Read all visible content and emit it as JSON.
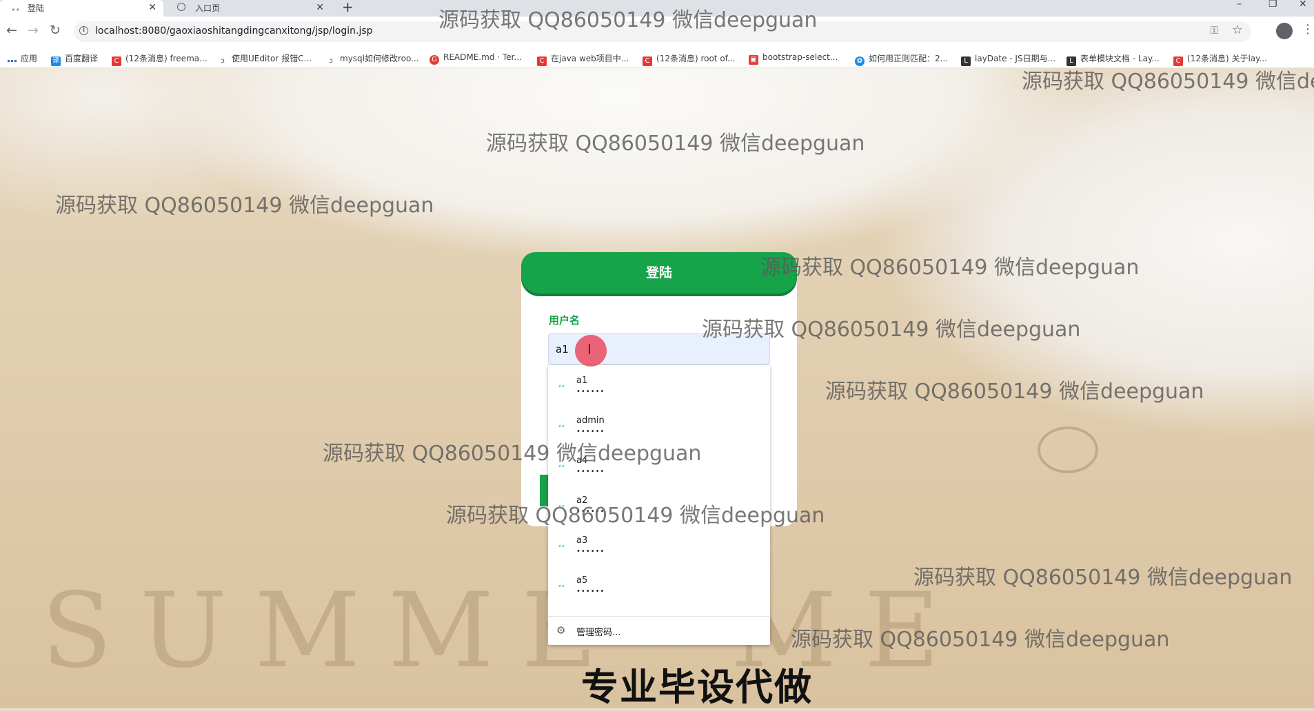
{
  "browser": {
    "tabs": [
      {
        "title": "登陆",
        "active": true
      },
      {
        "title": "入口页",
        "active": false
      }
    ],
    "url": "localhost:8080/gaoxiaoshitangdingcanxitong/jsp/login.jsp",
    "bookmarks": [
      {
        "label": "应用",
        "icon": "apps-icon"
      },
      {
        "label": "百度翻译",
        "icon": "translate-icon"
      },
      {
        "label": "(12条消息) freema...",
        "icon": "csdn-icon"
      },
      {
        "label": "使用UEditor 报错C...",
        "icon": "page-icon"
      },
      {
        "label": "mysql如何修改roo...",
        "icon": "page-icon"
      },
      {
        "label": "README.md · Ter...",
        "icon": "gitee-icon"
      },
      {
        "label": "在java web项目中...",
        "icon": "csdn-icon"
      },
      {
        "label": "(12条消息) root of...",
        "icon": "csdn-icon"
      },
      {
        "label": "bootstrap-select...",
        "icon": "page-icon"
      },
      {
        "label": "如何用正则匹配：2...",
        "icon": "baidu-icon"
      },
      {
        "label": "layDate - JS日期与...",
        "icon": "layui-icon"
      },
      {
        "label": "表单模块文档 - Lay...",
        "icon": "layui-icon"
      },
      {
        "label": "(12条消息) 关于lay...",
        "icon": "csdn-icon"
      }
    ]
  },
  "watermark_text": "源码获取 QQ86050149 微信deepguan",
  "login": {
    "header": "登陆",
    "username_label": "用户名",
    "username_value": "a1"
  },
  "autofill": {
    "items": [
      {
        "user": "a1",
        "password": "••••••"
      },
      {
        "user": "admin",
        "password": "••••••"
      },
      {
        "user": "a4",
        "password": "••••••"
      },
      {
        "user": "a2",
        "password": "••••••"
      },
      {
        "user": "a3",
        "password": "••••••"
      },
      {
        "user": "a5",
        "password": "••••••"
      }
    ],
    "manage_label": "管理密码..."
  },
  "banner": "专业毕设代做",
  "colors": {
    "accent_green": "#17a34a",
    "click_indicator": "#ea4a5e"
  }
}
